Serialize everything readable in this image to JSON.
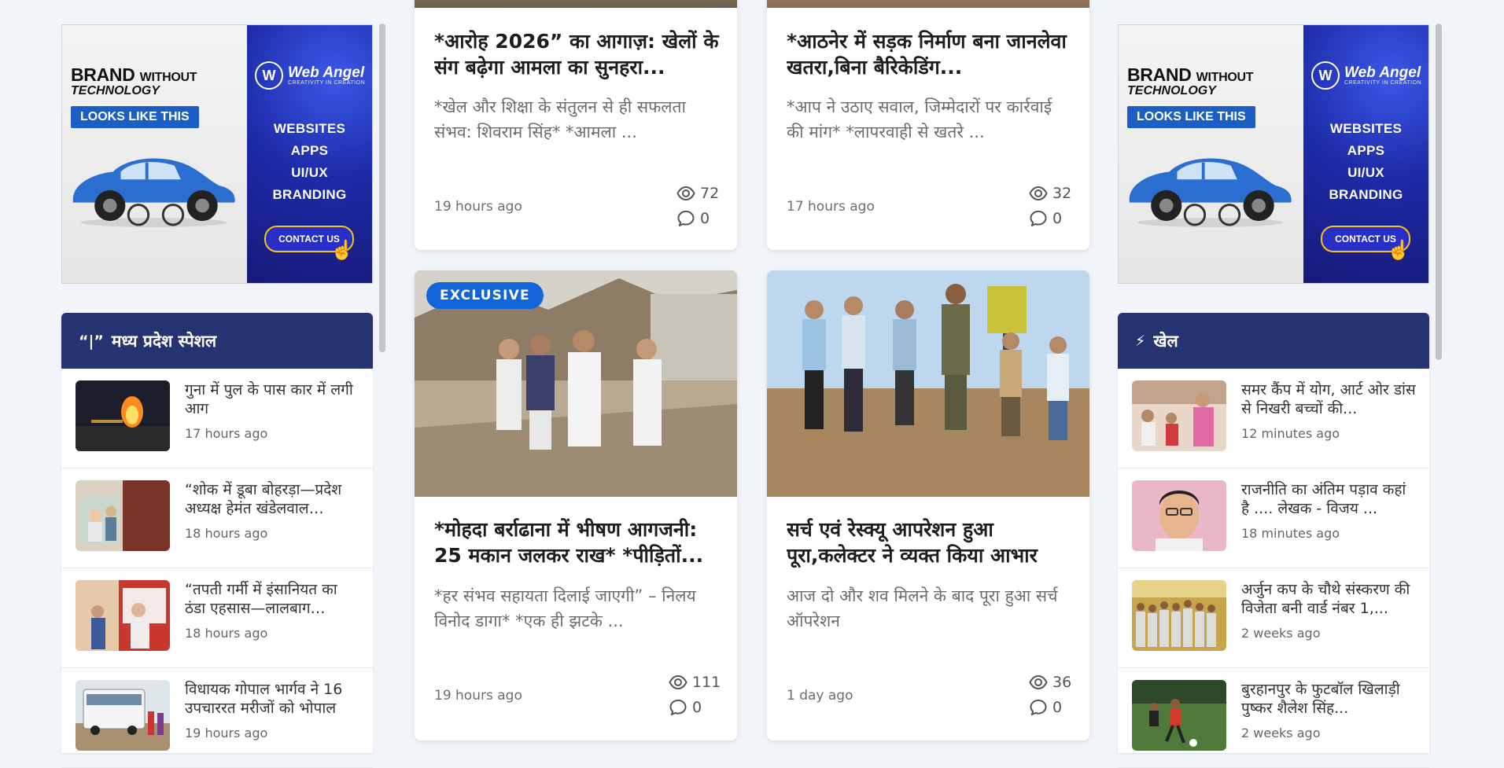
{
  "ad": {
    "brand_line1": "BRAND",
    "brand_line1_small": "WITHOUT",
    "brand_line2": "TECHNOLOGY",
    "pill": "LOOKS LIKE THIS",
    "logo_letter": "W",
    "logo_name": "Web Angel",
    "logo_tagline": "CREATIVITY IN CREATION",
    "services": [
      "WEBSITES",
      "APPS",
      "UI/UX",
      "BRANDING"
    ],
    "contact": "CONTACT US"
  },
  "left_widget": {
    "icon": "“|”",
    "title": "मध्य प्रदेश स्पेशल",
    "items": [
      {
        "title": "गुना में पुल के पास कार में लगी आग",
        "time": "17 hours ago"
      },
      {
        "title": "“शोक में डूबा बोहरड़ा—प्रदेश अध्यक्ष हेमंत खंडेलवाल…",
        "time": "18 hours ago"
      },
      {
        "title": "“तपती गर्मी में इंसानियत का ठंडा एहसास—लालबाग…",
        "time": "18 hours ago"
      },
      {
        "title": "विधायक गोपाल भार्गव ने 16 उपचाररत मरीजों को भोपाल",
        "time": "19 hours ago"
      }
    ]
  },
  "right_widget": {
    "icon": "⚡",
    "title": "खेल",
    "items": [
      {
        "title": "समर कैंप में योग, आर्ट ओर डांस से निखरी बच्चों की...",
        "time": "12 minutes ago"
      },
      {
        "title": "राजनीति का अंतिम पड़ाव कहां है .... लेखक - विजय ...",
        "time": "18 minutes ago"
      },
      {
        "title": "अर्जुन कप के चौथे संस्करण की विजेता बनी वार्ड नंबर 1,...",
        "time": "2 weeks ago"
      },
      {
        "title": "बुरहानपुर के फुटबॉल खिलाड़ी पुष्कर शैलेश सिंह...",
        "time": "2 weeks ago"
      }
    ]
  },
  "cards": [
    {
      "title": "*आरोह 2026” का आगाज़: खेलों के संग बढ़ेगा आमला का सुनहरा...",
      "excerpt": "*खेल और शिक्षा के संतुलन से ही सफलता संभव: शिवराम सिंह* *आमला ...",
      "time": "19 hours ago",
      "views": "72",
      "comments": "0"
    },
    {
      "title": "*आठनेर में सड़क निर्माण बना जानलेवा खतरा,बिना बैरिकेडिंग...",
      "excerpt": "*आप ने उठाए सवाल, जिम्मेदारों पर कार्रवाई की मांग* *लापरवाही से खतरे ...",
      "time": "17 hours ago",
      "views": "32",
      "comments": "0"
    },
    {
      "badge": "EXCLUSIVE",
      "title": "*मोहदा बर्राढाना में भीषण आगजनी: 25 मकान जलकर राख* *पीड़ितों...",
      "excerpt": "*हर संभव सहायता दिलाई जाएगी” – निलय विनोद डागा* *एक ही झटके ...",
      "time": "19 hours ago",
      "views": "111",
      "comments": "0"
    },
    {
      "title": "सर्च एवं रेस्क्यू आपरेशन हुआ पूरा,कलेक्टर ने व्यक्त किया आभार",
      "excerpt": "आज दो और शव मिलने के बाद पूरा हुआ सर्च ऑपरेशन",
      "time": "1 day ago",
      "views": "36",
      "comments": "0"
    }
  ],
  "colors": {
    "widget_header": "#253371",
    "badge": "#1265d8",
    "page_bg": "#f1f4f8"
  }
}
